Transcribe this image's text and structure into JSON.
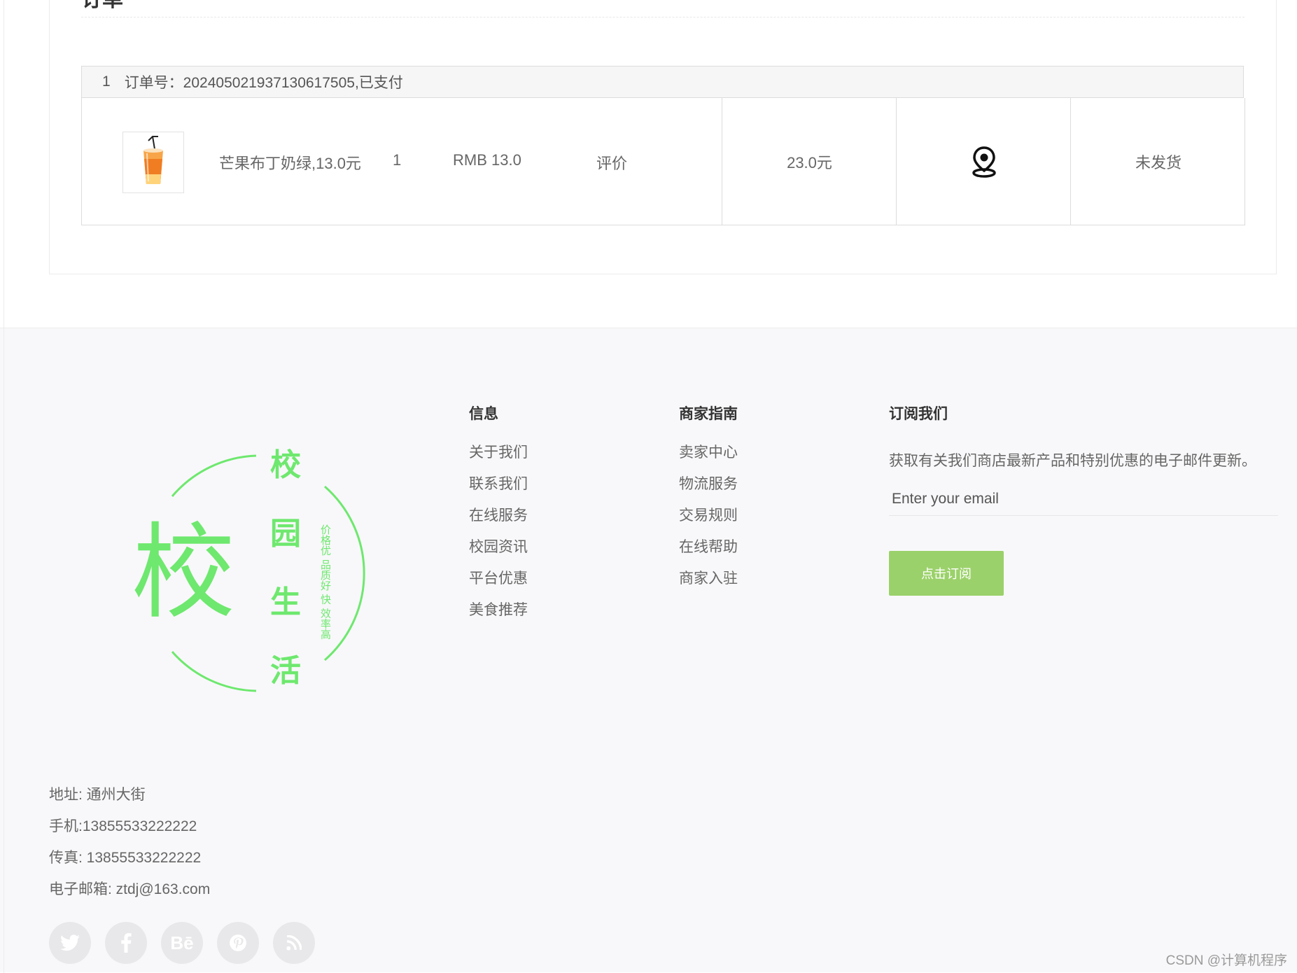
{
  "order_section": {
    "title_fragment": "订单"
  },
  "order": {
    "index": "1",
    "number_text": "订单号：20240502193713061750​5,已支付",
    "product_image_icon": "iced-drink-image",
    "product_name": "芒果布丁奶绿,13.0元",
    "quantity": "1",
    "price": "RMB  13.0",
    "review_label": "评价",
    "total": "23.0元",
    "address_icon": "map-pin-icon",
    "status": "未发货"
  },
  "footer": {
    "logo": {
      "big_char": "校",
      "side_chars": [
        "校",
        "园",
        "生",
        "活"
      ],
      "vertical_text": "价格优 品质好 快 效率高",
      "color": "#6ee86e"
    },
    "info": {
      "heading": "信息",
      "items": [
        "关于我们",
        "联系我们",
        "在线服务",
        "校园资讯",
        "平台优惠",
        "美食推荐"
      ]
    },
    "merchant": {
      "heading": "商家指南",
      "items": [
        "卖家中心",
        "物流服务",
        "交易规则",
        "在线帮助",
        "商家入驻"
      ]
    },
    "subscribe": {
      "heading": "订阅我们",
      "description": "获取有关我们商店最新产品和特别优惠的电子邮件更新。",
      "email_placeholder": "Enter your email",
      "button_label": "点击订阅",
      "button_color": "#9bd16a"
    },
    "contact": {
      "address": "地址: 通州大街",
      "phone": "手机:13855533222222",
      "fax": "传真: 13855533222222",
      "email": "电子邮箱: ztdj@163.com"
    },
    "socials": [
      {
        "name": "twitter-icon",
        "glyph": "🐦"
      },
      {
        "name": "facebook-icon",
        "glyph": "f"
      },
      {
        "name": "behance-icon",
        "glyph": "Bē"
      },
      {
        "name": "pinterest-icon",
        "glyph": "P"
      },
      {
        "name": "rss-icon",
        "glyph": ")"
      }
    ]
  },
  "watermark": "CSDN @计算机程序"
}
